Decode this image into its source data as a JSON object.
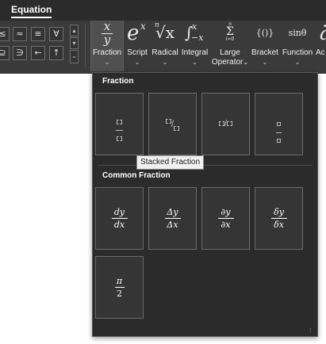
{
  "tabs": {
    "equation_label": "Equation"
  },
  "symbols": {
    "row1": [
      "≤",
      "≈",
      "≡",
      "∀"
    ],
    "row2": [
      "⊇",
      "∋",
      "←",
      "↑"
    ],
    "scroll_up": "▴",
    "scroll_down": "▾",
    "more": "⌄"
  },
  "gallery": {
    "fraction_label": "Fraction",
    "script_label": "Script",
    "radical_label": "Radical",
    "integral_label": "Integral",
    "large_operator_label_1": "Large",
    "large_operator_label_2": "Operator",
    "bracket_label": "Bracket",
    "function_label": "Function",
    "accent_label": "Ac",
    "chevron": "⌄",
    "fraction_icon_num": "x",
    "fraction_icon_den": "y",
    "script_icon_base": "e",
    "script_icon_sup": "x",
    "radical_icon_index": "n",
    "radical_icon_rad": "√x",
    "integral_icon": "∫",
    "integral_icon_sup": "x",
    "integral_icon_sub": "−x",
    "large_operator_icon_top": "n",
    "large_operator_icon": "Σ",
    "large_operator_icon_bottom": "i=0",
    "bracket_icon": "{()}",
    "function_icon": "sinθ",
    "accent_icon": "ä"
  },
  "dropdown": {
    "section_fraction": "Fraction",
    "section_common": "Common Fraction",
    "linear_slash": "/",
    "common": [
      {
        "num": "dy",
        "den": "dx"
      },
      {
        "num": "Δy",
        "den": "Δx"
      },
      {
        "num": "∂y",
        "den": "∂x"
      },
      {
        "num": "δy",
        "den": "δx"
      },
      {
        "num": "π",
        "den": "2"
      }
    ]
  },
  "tooltip": {
    "text": "Stacked Fraction"
  },
  "colors": {
    "ribbon": "#2b2b2b",
    "ribbon_body": "#3a3a3a",
    "selected": "#505050",
    "dropdown_bg": "#2b2b2b",
    "tooltip_bg": "#f0f0f0"
  }
}
